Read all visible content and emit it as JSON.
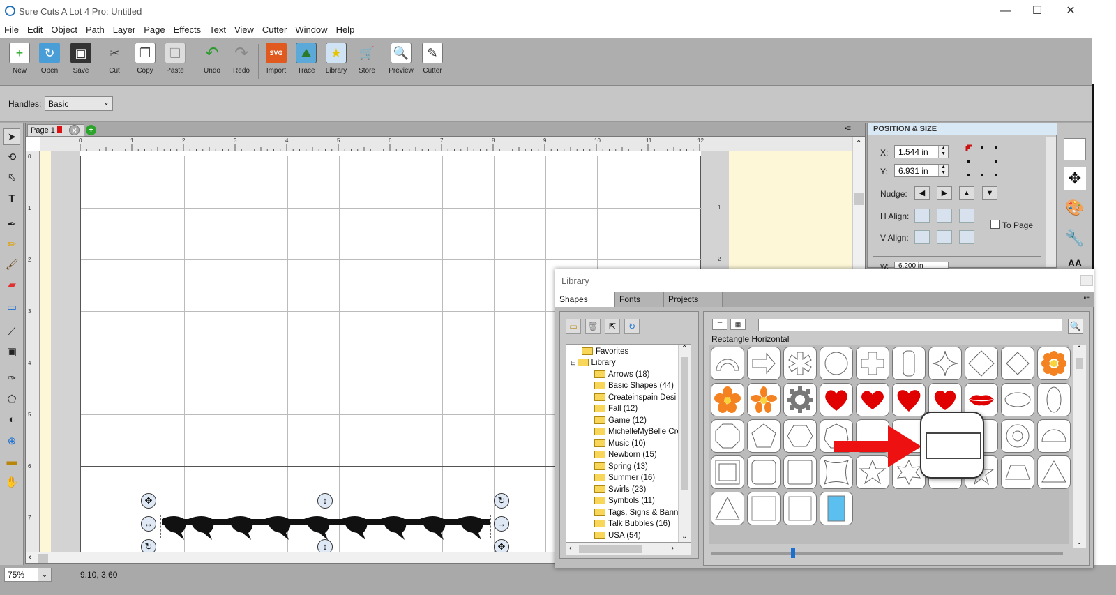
{
  "window": {
    "title": "Sure Cuts A Lot 4 Pro: Untitled",
    "minimize": "—",
    "maximize": "☐",
    "close": "✕"
  },
  "menu": [
    "File",
    "Edit",
    "Object",
    "Path",
    "Layer",
    "Page",
    "Effects",
    "Text",
    "View",
    "Cutter",
    "Window",
    "Help"
  ],
  "toolbar": {
    "buttons": [
      {
        "label": "New",
        "icon": "new-icon"
      },
      {
        "label": "Open",
        "icon": "open-icon"
      },
      {
        "label": "Save",
        "icon": "save-icon"
      },
      {
        "label": "Cut",
        "icon": "cut-icon"
      },
      {
        "label": "Copy",
        "icon": "copy-icon"
      },
      {
        "label": "Paste",
        "icon": "paste-icon"
      },
      {
        "label": "Undo",
        "icon": "undo-icon"
      },
      {
        "label": "Redo",
        "icon": "redo-icon"
      },
      {
        "label": "Import",
        "icon": "import-svg-icon"
      },
      {
        "label": "Trace",
        "icon": "trace-icon"
      },
      {
        "label": "Library",
        "icon": "library-star-icon"
      },
      {
        "label": "Store",
        "icon": "store-cart-icon"
      },
      {
        "label": "Preview",
        "icon": "preview-magnifier-icon"
      },
      {
        "label": "Cutter",
        "icon": "cutter-icon"
      }
    ]
  },
  "handles": {
    "label": "Handles:",
    "value": "Basic"
  },
  "page": {
    "tab_label": "Page 1"
  },
  "ruler": {
    "top": [
      "0",
      "1",
      "2",
      "3",
      "4",
      "5",
      "6",
      "7",
      "8",
      "9",
      "10",
      "11",
      "12"
    ],
    "left": [
      "0",
      "1",
      "2",
      "3",
      "4",
      "5",
      "6",
      "7"
    ],
    "right": [
      "1",
      "2"
    ]
  },
  "status": {
    "zoom": "75%",
    "coords": "9.10, 3.60"
  },
  "position_size": {
    "header": "POSITION & SIZE",
    "x_label": "X:",
    "x_value": "1.544 in",
    "y_label": "Y:",
    "y_value": "6.931 in",
    "nudge_label": "Nudge:",
    "halign_label": "H Align:",
    "valign_label": "V Align:",
    "to_page": "To Page",
    "w_label": "W:",
    "w_value": "6.200 in"
  },
  "library": {
    "title": "Library",
    "tabs": [
      "Shapes",
      "Fonts",
      "Projects"
    ],
    "tree": [
      {
        "label": "Favorites",
        "level": 1
      },
      {
        "label": "Library",
        "level": 0
      },
      {
        "label": "Arrows (18)",
        "level": 2
      },
      {
        "label": "Basic Shapes (44)",
        "level": 2
      },
      {
        "label": "Createinspain Desi",
        "level": 2
      },
      {
        "label": "Fall (12)",
        "level": 2
      },
      {
        "label": "Game (12)",
        "level": 2
      },
      {
        "label": "MichelleMyBelle Cre",
        "level": 2
      },
      {
        "label": "Music (10)",
        "level": 2
      },
      {
        "label": "Newborn (15)",
        "level": 2
      },
      {
        "label": "Spring (13)",
        "level": 2
      },
      {
        "label": "Summer (16)",
        "level": 2
      },
      {
        "label": "Swirls (23)",
        "level": 2
      },
      {
        "label": "Symbols (11)",
        "level": 2
      },
      {
        "label": "Tags, Signs & Bann",
        "level": 2
      },
      {
        "label": "Talk Bubbles (16)",
        "level": 2
      },
      {
        "label": "USA (54)",
        "level": 2
      }
    ],
    "selected_shape": "Rectangle Horizontal",
    "colors": {
      "flower": "#f58220",
      "heart": "#e00000",
      "light_blue": "#5bc0f0",
      "arrow_red": "#ee1111"
    }
  }
}
